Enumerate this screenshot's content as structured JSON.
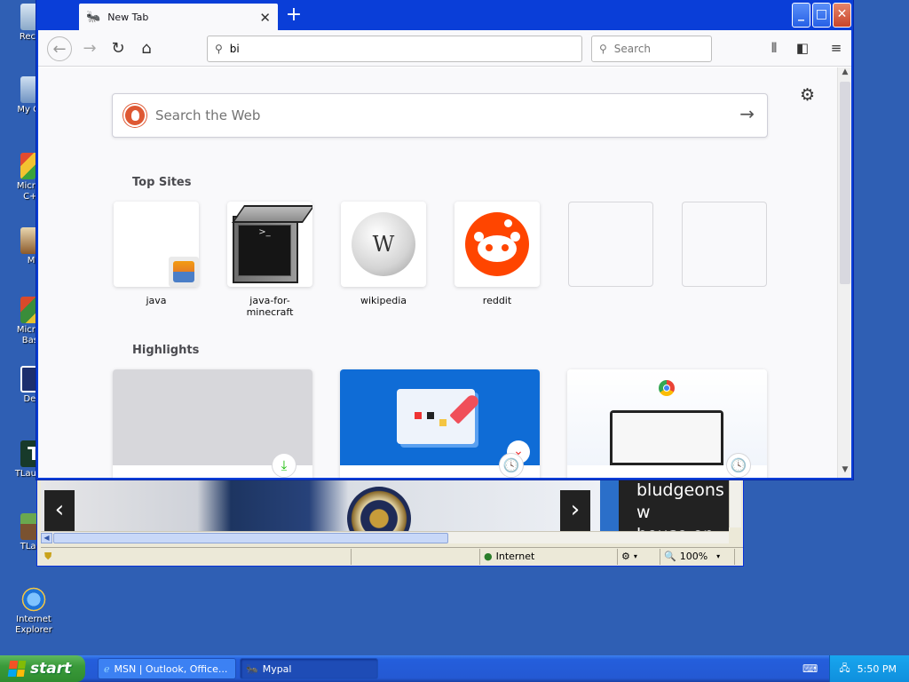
{
  "desktop": {
    "icons": [
      {
        "label": "Recycl"
      },
      {
        "label": "My Con"
      },
      {
        "label": "Microso\nC++"
      },
      {
        "label": "My"
      },
      {
        "label": "Microso\nBasic"
      },
      {
        "label": "Dev-"
      },
      {
        "label": "TLaunch"
      },
      {
        "label": "TLaun"
      },
      {
        "label": "Internet\nExplorer"
      }
    ]
  },
  "taskbar": {
    "start_label": "start",
    "tasks": [
      {
        "label": "MSN | Outlook, Office..."
      },
      {
        "label": "Mypal"
      }
    ],
    "clock": "5:50 PM"
  },
  "ie_window": {
    "story_text": "bludgeons w\nhouse on fir",
    "status_zone": "Internet",
    "zoom": "100%"
  },
  "browser": {
    "tab_title": "New Tab",
    "url_value": "bi",
    "search_placeholder": "Search",
    "content": {
      "web_search_placeholder": "Search the Web",
      "top_sites_heading": "Top Sites",
      "top_sites": [
        {
          "name": "java",
          "icon": "java-icon"
        },
        {
          "name": "java-for-minecraft",
          "icon": "terminal-icon"
        },
        {
          "name": "wikipedia",
          "icon": "wikipedia-icon"
        },
        {
          "name": "reddit",
          "icon": "reddit-icon"
        },
        {
          "name": "",
          "icon": ""
        },
        {
          "name": "",
          "icon": ""
        }
      ],
      "highlights_heading": "Highlights",
      "highlights": [
        {
          "icon": "download-icon"
        },
        {
          "icon": "history-icon"
        },
        {
          "icon": "history-icon"
        }
      ]
    }
  },
  "colors": {
    "xp_blue": "#0a3ed8",
    "desktop": "#2f5fb4",
    "reddit": "#ff4500",
    "highlight_blue": "#0f6cd6"
  }
}
